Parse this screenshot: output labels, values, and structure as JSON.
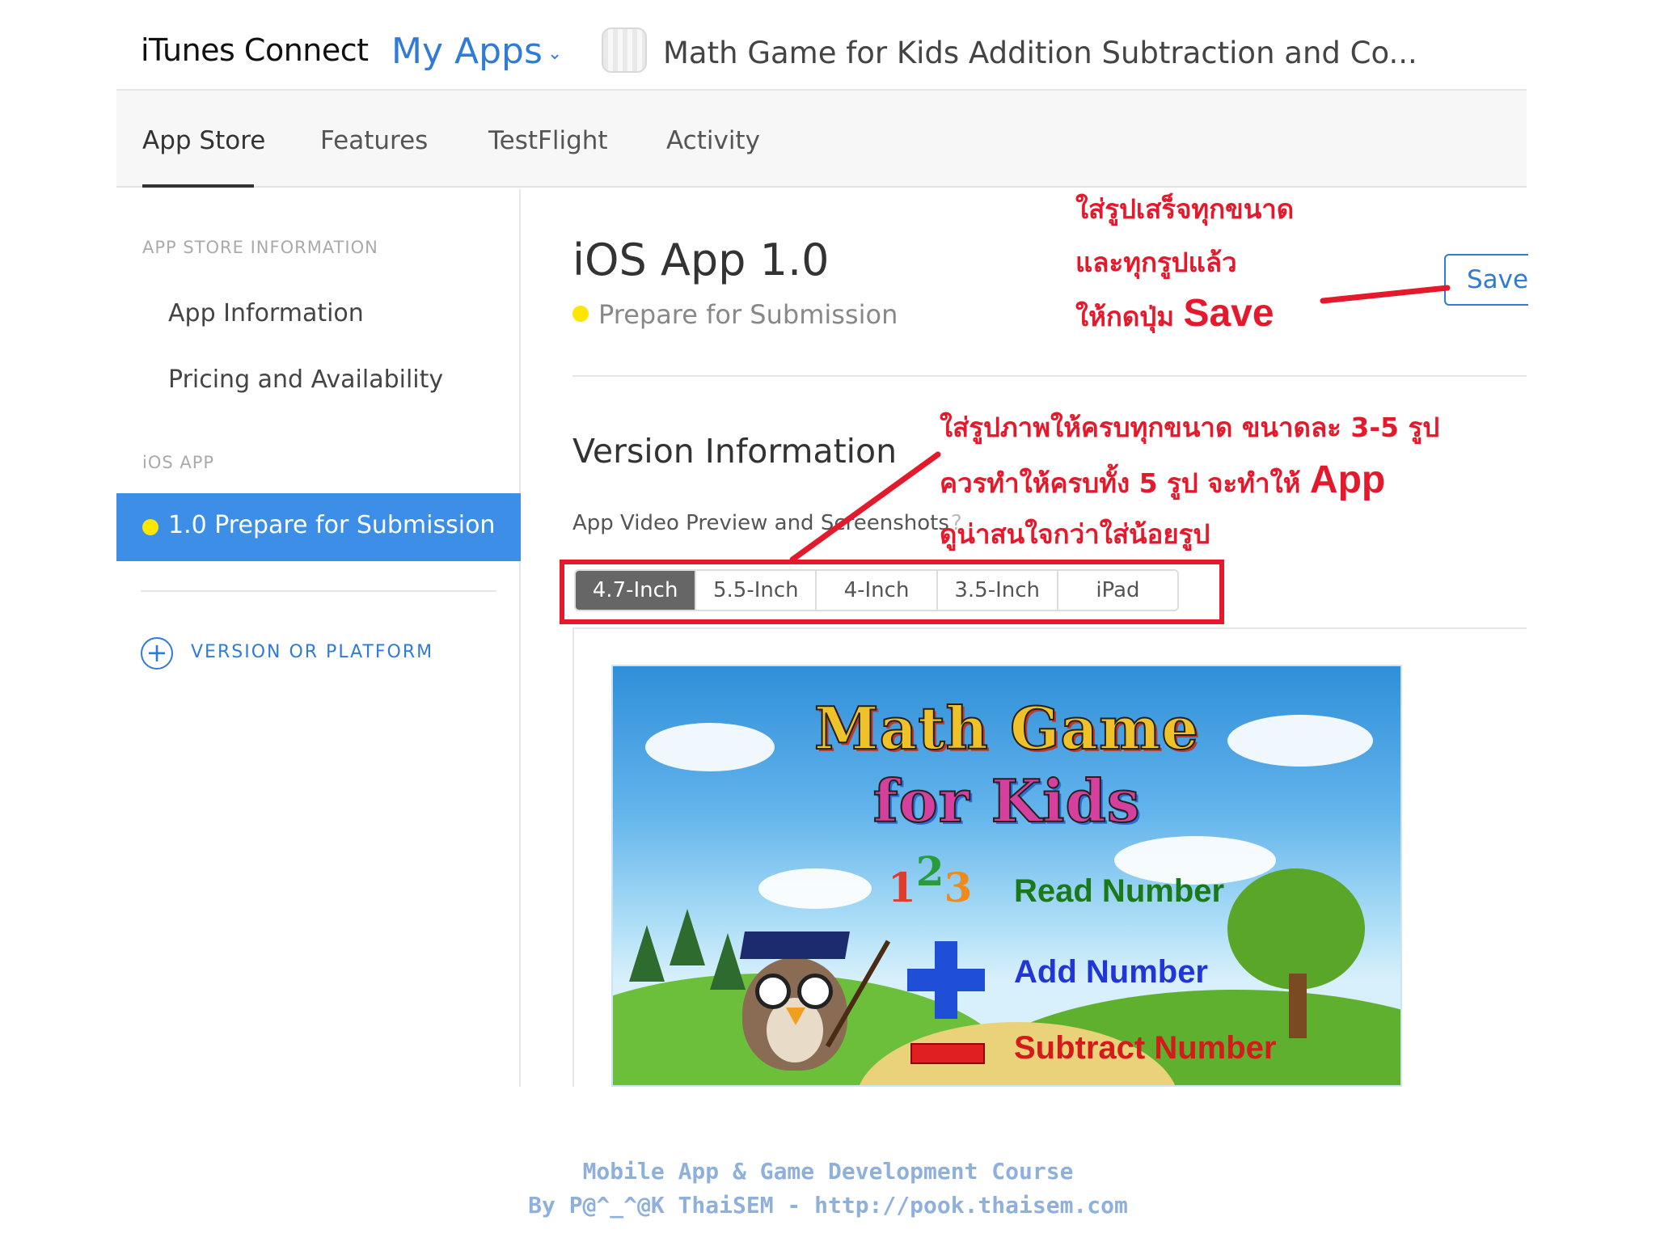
{
  "header": {
    "brand": "iTunes Connect",
    "my_apps": "My Apps",
    "app_title": "Math Game for Kids Addition Subtraction and Co..."
  },
  "tabs": [
    {
      "label": "App Store",
      "active": true
    },
    {
      "label": "Features"
    },
    {
      "label": "TestFlight"
    },
    {
      "label": "Activity"
    }
  ],
  "sidebar": {
    "section1": "APP STORE INFORMATION",
    "items": [
      "App Information",
      "Pricing and Availability"
    ],
    "section2": "iOS APP",
    "active_item": "1.0 Prepare for Submission",
    "add_version": "VERSION OR PLATFORM"
  },
  "main": {
    "title": "iOS App 1.0",
    "status": "Prepare for Submission",
    "save": "Save",
    "section_title": "Version Information",
    "media_label": "App Video Preview and Screenshots",
    "help": "?",
    "device_tabs": [
      "4.7-Inch",
      "5.5-Inch",
      "4-Inch",
      "3.5-Inch",
      "iPad"
    ],
    "active_device": "4.7-Inch"
  },
  "preview": {
    "title_line1": "Math Game",
    "title_line2": "for Kids",
    "numbers": [
      "1",
      "2",
      "3"
    ],
    "line1": "Read Number",
    "line2": "Add Number",
    "line3": "Subtract Number"
  },
  "annotations": {
    "save_note_1": "ใส่รูปเสร็จทุกขนาด",
    "save_note_2": "และทุกรูปแล้ว",
    "save_note_3_pre": "ให้กดปุ่ม ",
    "save_note_3_big": "Save",
    "shots_note_1": "ใส่รูปภาพให้ครบทุกขนาด ขนาดละ 3-5 รูป",
    "shots_note_2_pre": "ควรทำให้ครบทั้ง 5 รูป จะทำให้ ",
    "shots_note_2_big": "App",
    "shots_note_3": "ดูน่าสนใจกว่าใส่น้อยรูป"
  },
  "credit": {
    "line1": "Mobile App & Game Development Course",
    "line2": "By P@^_^@K ThaiSEM - http://pook.thaisem.com"
  },
  "colors": {
    "accent": "#2f7bd6",
    "sidebar_active": "#3d8ee6",
    "status_dot": "#ffe600",
    "annotation": "#e5192c"
  }
}
